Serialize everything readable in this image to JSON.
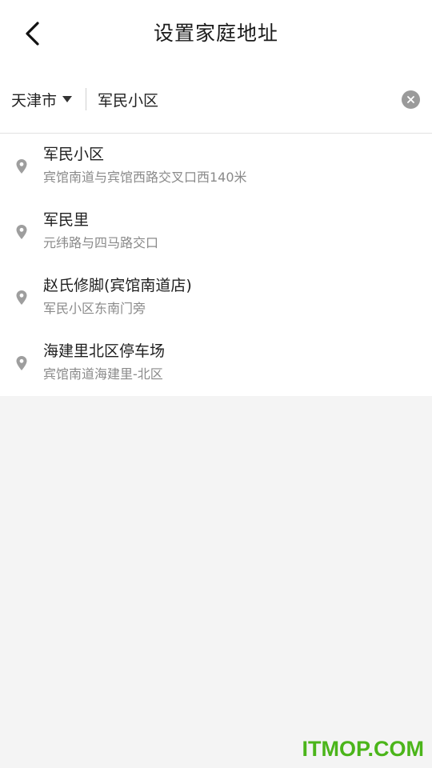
{
  "header": {
    "title": "设置家庭地址",
    "back_icon": "chevron-left-icon"
  },
  "search": {
    "city": "天津市",
    "city_caret_icon": "caret-down-icon",
    "query": "军民小区",
    "clear_icon": "clear-circle-icon"
  },
  "results": [
    {
      "name": "军民小区",
      "address": "宾馆南道与宾馆西路交叉口西140米",
      "icon": "location-pin-icon"
    },
    {
      "name": "军民里",
      "address": "元纬路与四马路交口",
      "icon": "location-pin-icon"
    },
    {
      "name": "赵氏修脚(宾馆南道店)",
      "address": "军民小区东南门旁",
      "icon": "location-pin-icon"
    },
    {
      "name": "海建里北区停车场",
      "address": "宾馆南道海建里-北区",
      "icon": "location-pin-icon"
    }
  ],
  "watermark": "ITMOP.COM",
  "colors": {
    "background": "#f4f4f4",
    "surface": "#ffffff",
    "secondary_text": "#8a8a8a",
    "icon_gray": "#9a9a9a",
    "watermark": "#4bb51a"
  }
}
